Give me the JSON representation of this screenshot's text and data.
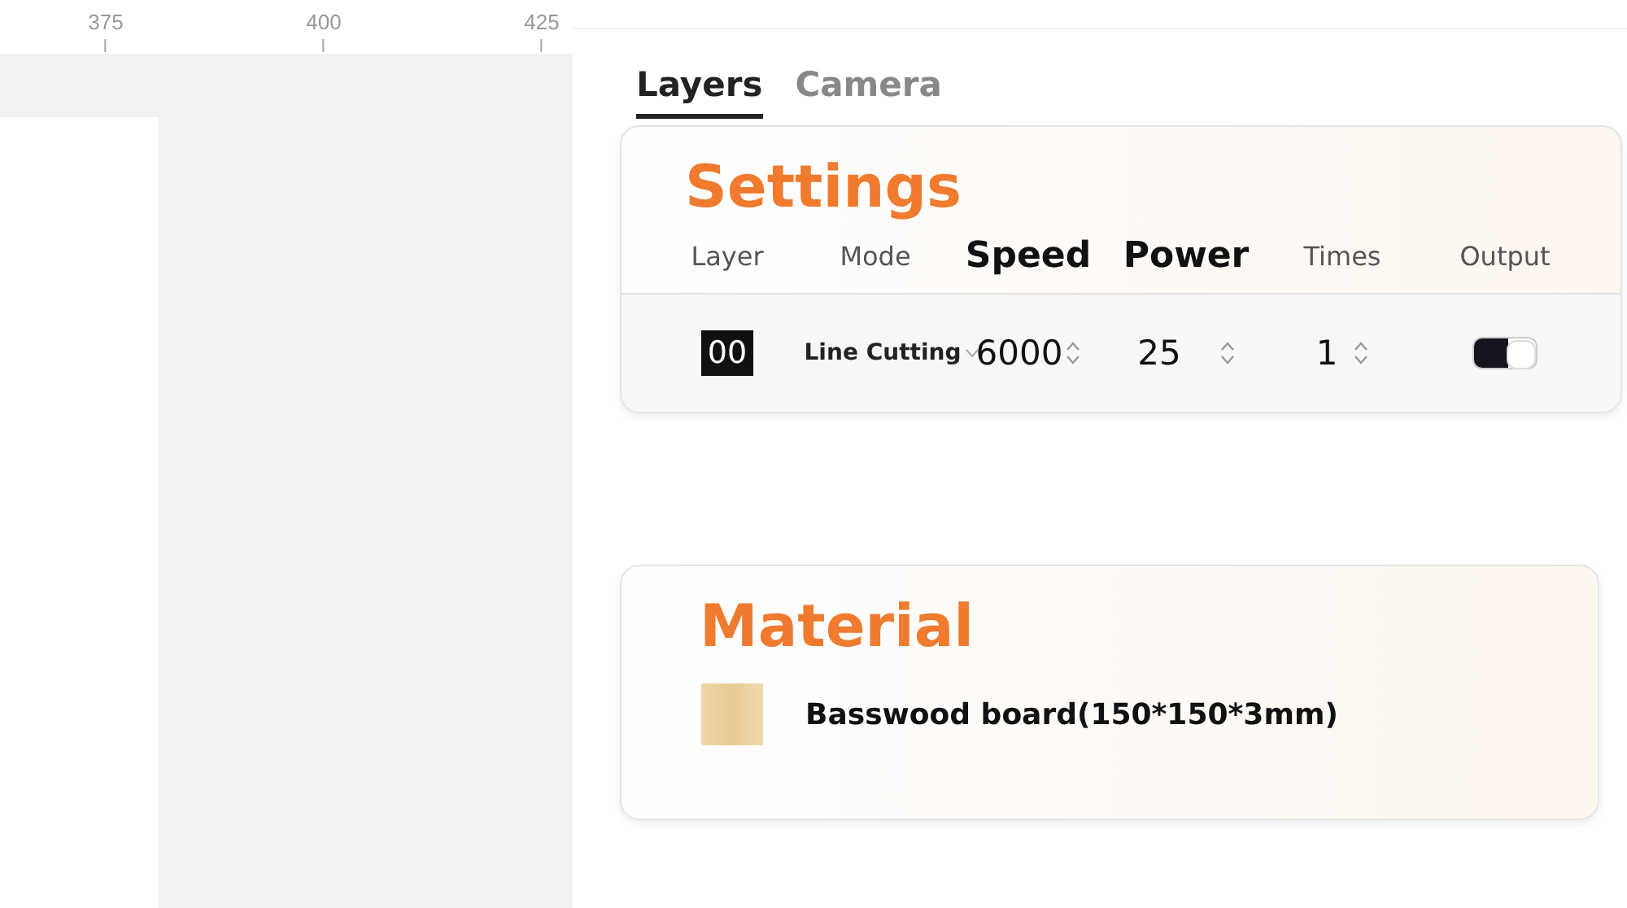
{
  "ruler": {
    "ticks": [
      {
        "label": "375"
      },
      {
        "label": "400"
      },
      {
        "label": "425"
      }
    ]
  },
  "tabs": [
    {
      "label": "Layers",
      "selected": true
    },
    {
      "label": "Camera",
      "selected": false
    }
  ],
  "settings": {
    "title": "Settings",
    "columns": [
      {
        "label": "Layer",
        "emphasized": false
      },
      {
        "label": "Mode",
        "emphasized": false
      },
      {
        "label": "Speed",
        "emphasized": true
      },
      {
        "label": "Power",
        "emphasized": true
      },
      {
        "label": "Times",
        "emphasized": false
      },
      {
        "label": "Output",
        "emphasized": false
      }
    ],
    "rows": [
      {
        "layer": "00",
        "mode": "Line Cutting",
        "speed": "6000",
        "power": "25",
        "times": "1",
        "output": true
      }
    ]
  },
  "material": {
    "title": "Material",
    "name": "Basswood board(150*150*3mm)"
  }
}
